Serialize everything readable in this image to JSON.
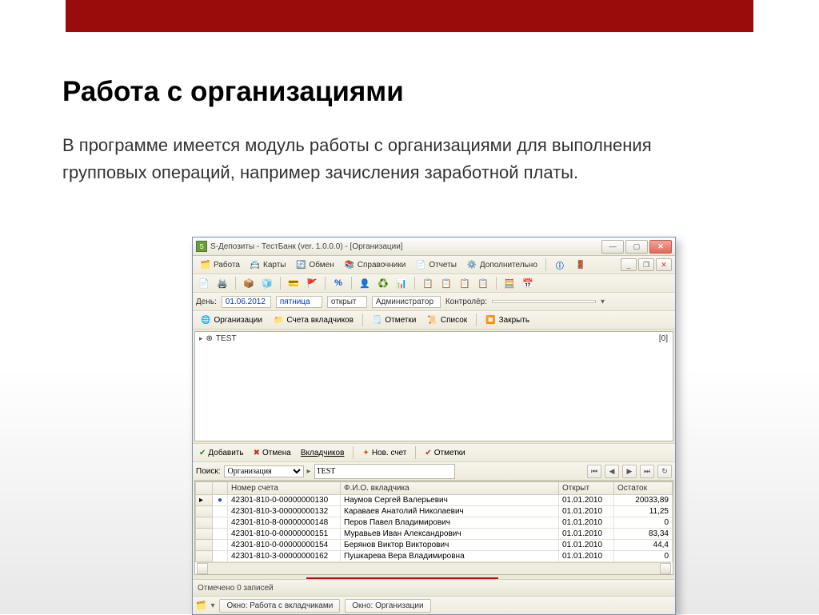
{
  "slide": {
    "heading": "Работа с организациями",
    "text": "В программе имеется модуль работы с организациями для выполнения групповых операций, например зачисления заработной платы."
  },
  "window": {
    "title": "S-Депозиты - ТестБанк (ver. 1.0.0.0) - [Организации]",
    "menu": {
      "work": "Работа",
      "cards": "Карты",
      "exchange": "Обмен",
      "refs": "Справочники",
      "reports": "Отчеты",
      "extra": "Дополнительно"
    },
    "info": {
      "day_lbl": "День:",
      "date": "01.06.2012",
      "weekday": "пятница",
      "state": "открыт",
      "admin": "Администратор",
      "ctrl_lbl": "Контролёр:",
      "ctrl": ""
    },
    "tabs": {
      "orgs": "Организации",
      "accounts": "Счета вкладчиков",
      "marks": "Отметки",
      "list": "Список",
      "close": "Закрыть"
    },
    "tree": {
      "root": "TEST",
      "count": "[0]"
    },
    "actions": {
      "add": "Добавить",
      "cancel": "Отмена",
      "depositors": "Вкладчиков",
      "newacc": "Нов. счет",
      "marks": "Отметки"
    },
    "search": {
      "lbl": "Поиск:",
      "mode": "Организация",
      "value": "TEST"
    },
    "grid": {
      "columns": {
        "acc": "Номер счета",
        "fio": "Ф.И.О. вкладчика",
        "opened": "Открыт",
        "balance": "Остаток"
      },
      "rows": [
        {
          "acc": "42301-810-0-00000000130",
          "fio": "Наумов Сергей Валерьевич",
          "opened": "01.01.2010",
          "balance": "20033,89"
        },
        {
          "acc": "42301-810-3-00000000132",
          "fio": "Караваев Анатолий Николаевич",
          "opened": "01.01.2010",
          "balance": "11,25"
        },
        {
          "acc": "42301-810-8-00000000148",
          "fio": "Перов Павел Владимирович",
          "opened": "01.01.2010",
          "balance": "0"
        },
        {
          "acc": "42301-810-0-00000000151",
          "fio": "Муравьев Иван Александрович",
          "opened": "01.01.2010",
          "balance": "83,34"
        },
        {
          "acc": "42301-810-0-00000000154",
          "fio": "Берянов Виктор Викторович",
          "opened": "01.01.2010",
          "balance": "44,4"
        },
        {
          "acc": "42301-810-3-00000000162",
          "fio": "Пушкарева Вера Владимировна",
          "opened": "01.01.2010",
          "balance": "0"
        }
      ]
    },
    "status": "Отмечено 0 записей",
    "switch": {
      "a": "Окно: Работа с вкладчиками",
      "b": "Окно: Организации"
    }
  }
}
